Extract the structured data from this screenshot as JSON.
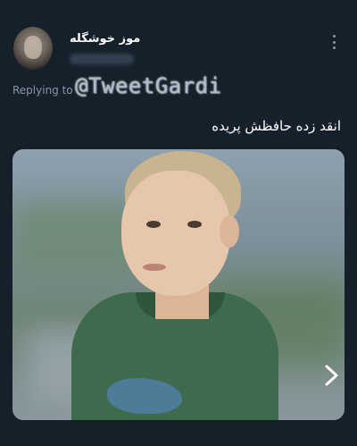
{
  "tweet": {
    "author_display_name": "موز خوشگله",
    "reply_prefix": "Replying to",
    "text": "انقد زده حافظش پریده"
  },
  "watermark": "@TweetGardi",
  "media": {
    "alt": "child with a confused look",
    "next_icon": "chevron-right-icon"
  },
  "colors": {
    "background": "#15202b",
    "secondary_text": "#8899a6"
  }
}
